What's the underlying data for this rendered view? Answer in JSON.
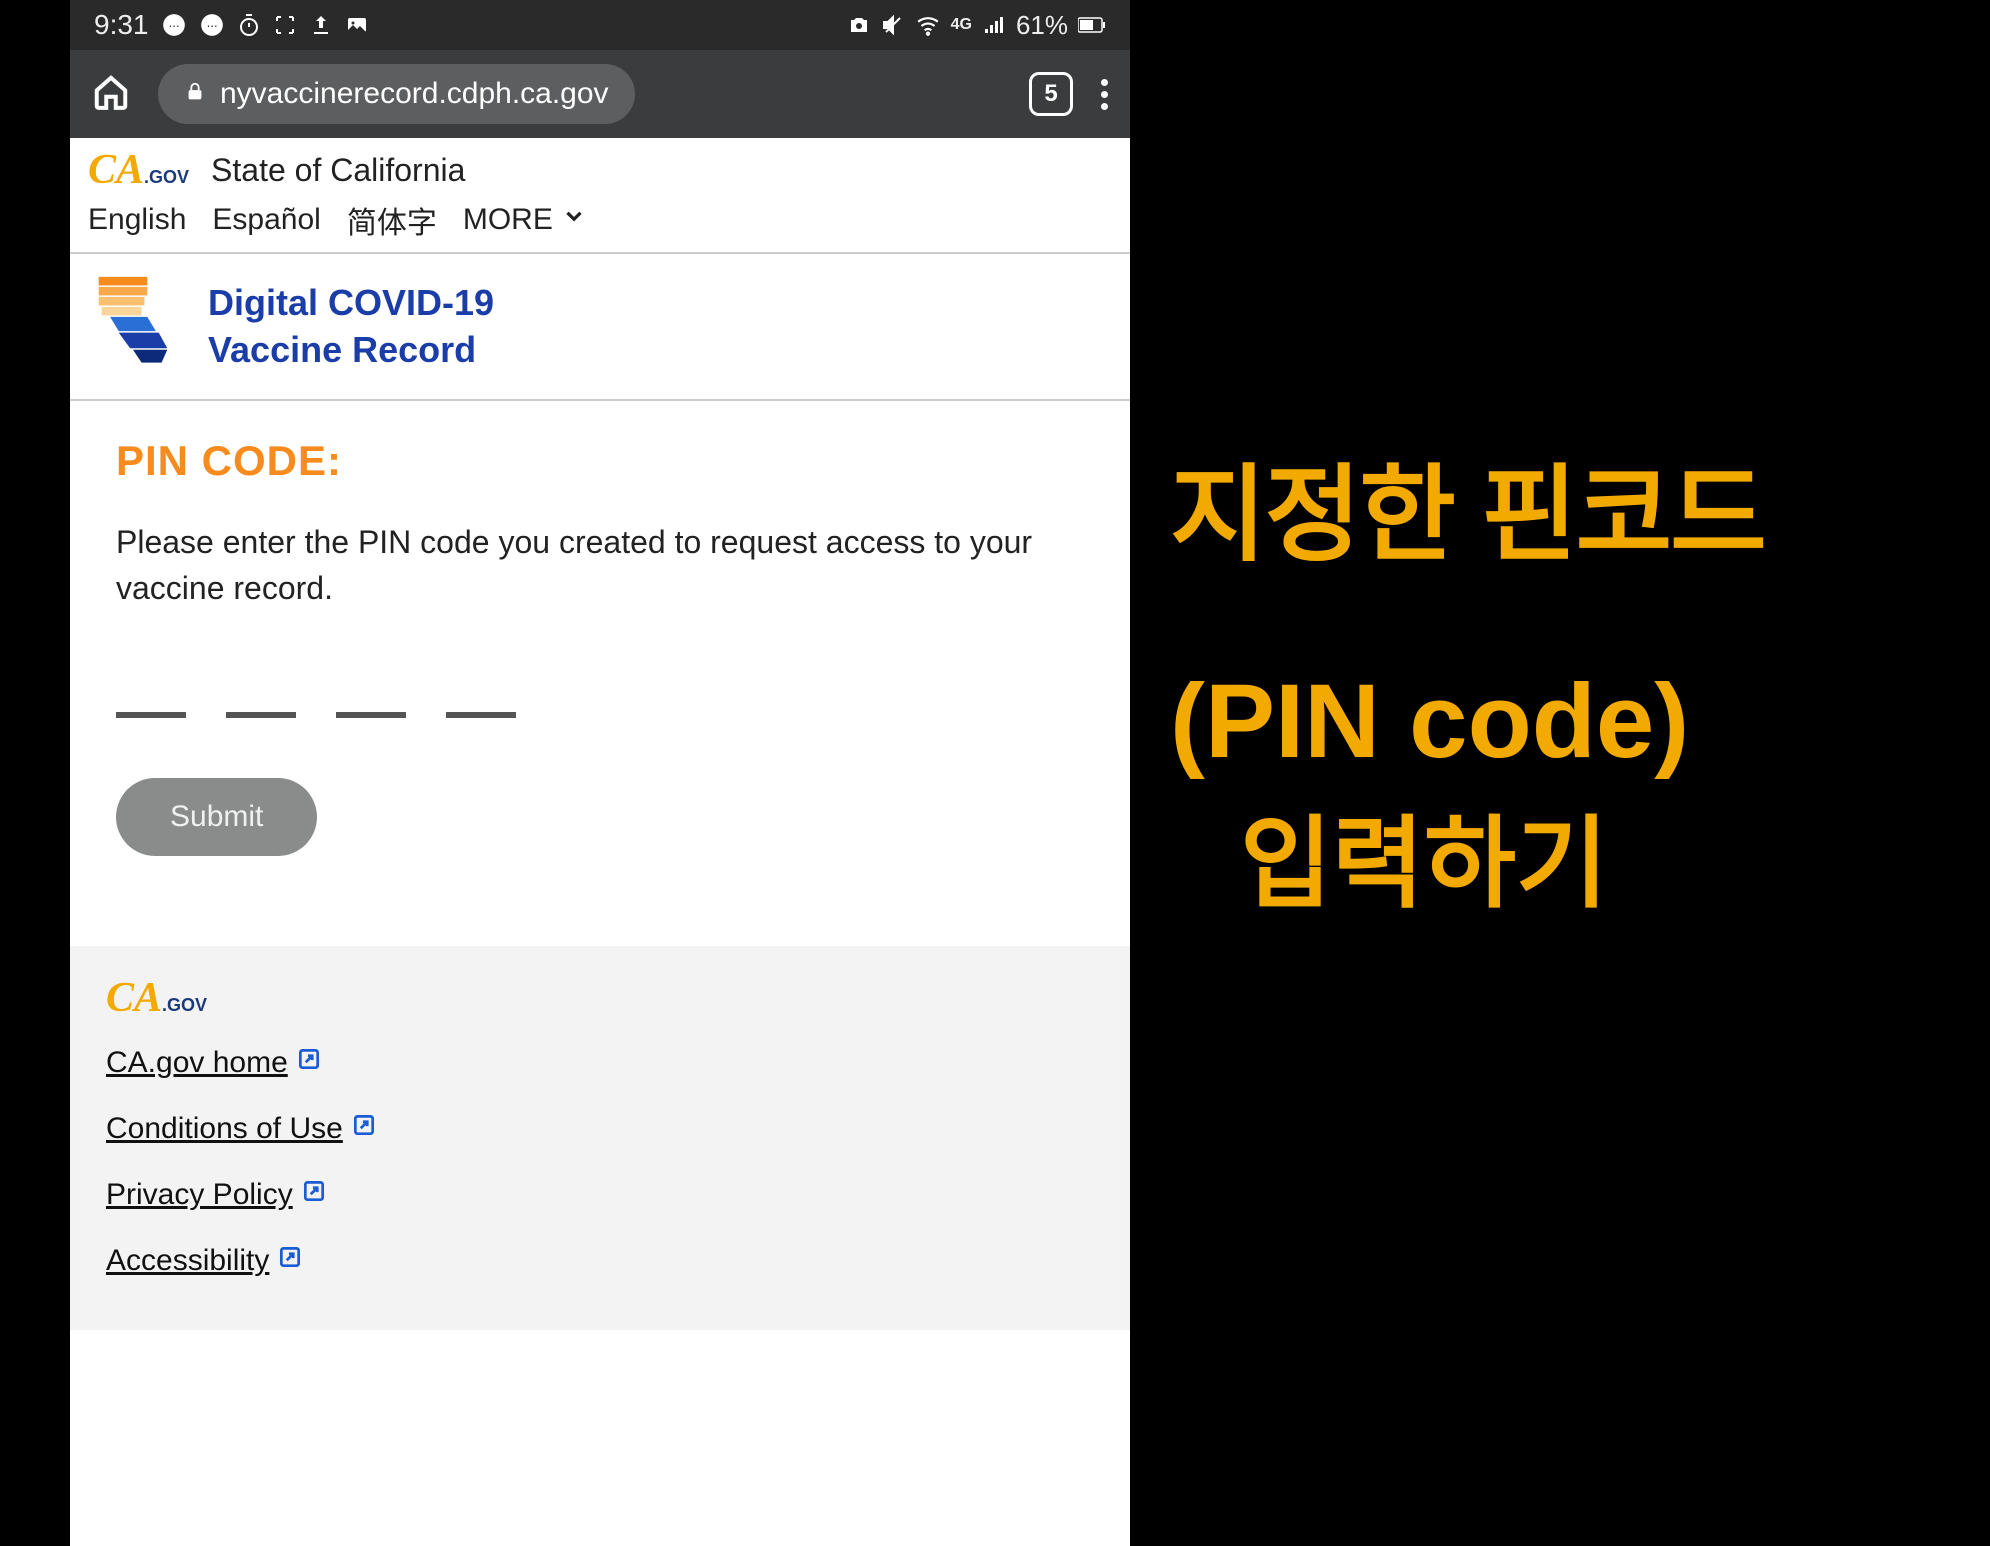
{
  "status": {
    "time": "9:31",
    "battery": "61%",
    "icons": {
      "chat1": "chat-icon",
      "chat2": "chat-icon",
      "timer": "timer-icon",
      "focus": "focus-icon",
      "upload": "upload-icon",
      "image": "image-icon",
      "camera": "camera-icon",
      "mute": "mute-icon",
      "wifi": "wifi-icon",
      "lte": "4G",
      "signal": "signal-icon",
      "battery_icon": "battery-icon"
    }
  },
  "browser": {
    "url": "nyvaccinerecord.cdph.ca.gov",
    "tab_count": "5"
  },
  "gov_header": {
    "logo_ca": "CA",
    "logo_gov": ".GOV",
    "state_label": "State of California"
  },
  "languages": [
    "English",
    "Español",
    "简体字"
  ],
  "lang_more": "MORE",
  "site_title": {
    "line1": "Digital COVID-19",
    "line2": "Vaccine Record"
  },
  "pin": {
    "heading": "PIN CODE:",
    "instruction": "Please enter the PIN code you created to request access to your vaccine record.",
    "submit_label": "Submit"
  },
  "footer": {
    "logo_ca": "CA",
    "logo_gov": ".GOV",
    "links": [
      "CA.gov home",
      "Conditions of Use",
      "Privacy Policy",
      "Accessibility"
    ]
  },
  "annotation": {
    "line1": "지정한 핀코드",
    "line2": "(PIN code)",
    "line3": "입력하기"
  }
}
